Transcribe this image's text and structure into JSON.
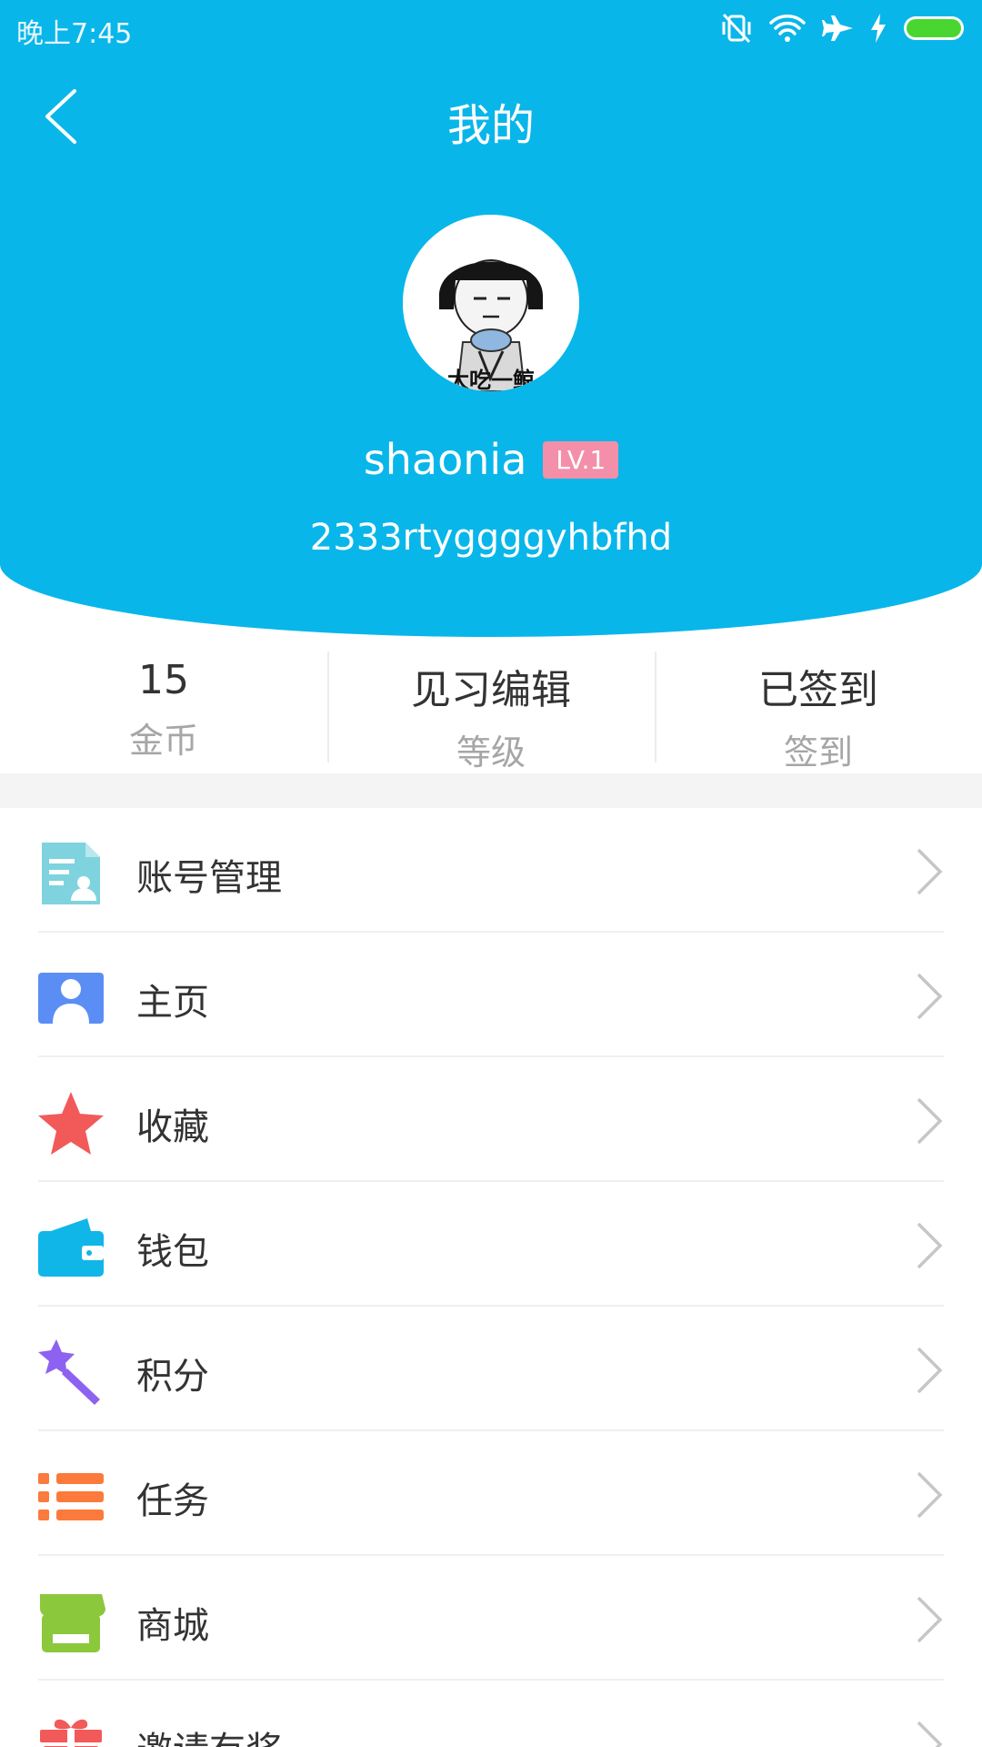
{
  "statusbar": {
    "time": "晚上7:45",
    "icons": [
      "vibrate-off-icon",
      "wifi-icon",
      "airplane-icon",
      "charging-icon",
      "battery-icon"
    ]
  },
  "header": {
    "title": "我的",
    "back_icon": "back-chevron-icon",
    "username": "shaonia",
    "level": "LV.1",
    "signature": "2333rtyggggyhbfhd",
    "avatar_caption": "大吃一鲸",
    "bg_color": "#09b6e9"
  },
  "stats": [
    {
      "value": "15",
      "label": "金币"
    },
    {
      "value": "见习编辑",
      "label": "等级"
    },
    {
      "value": "已签到",
      "label": "签到"
    }
  ],
  "menu": [
    {
      "label": "账号管理",
      "icon": "account-card-icon",
      "color": "#7ed3de"
    },
    {
      "label": "主页",
      "icon": "profile-icon",
      "color": "#5b8ef5"
    },
    {
      "label": "收藏",
      "icon": "star-icon",
      "color": "#f25a5a"
    },
    {
      "label": "钱包",
      "icon": "wallet-icon",
      "color": "#10b6e8"
    },
    {
      "label": "积分",
      "icon": "magic-wand-icon",
      "color": "#8d62f0"
    },
    {
      "label": "任务",
      "icon": "task-list-icon",
      "color": "#fb7a3c"
    },
    {
      "label": "商城",
      "icon": "shop-icon",
      "color": "#8cc83c"
    },
    {
      "label": "邀请有奖",
      "icon": "gift-icon",
      "color": "#f25a5a"
    }
  ]
}
